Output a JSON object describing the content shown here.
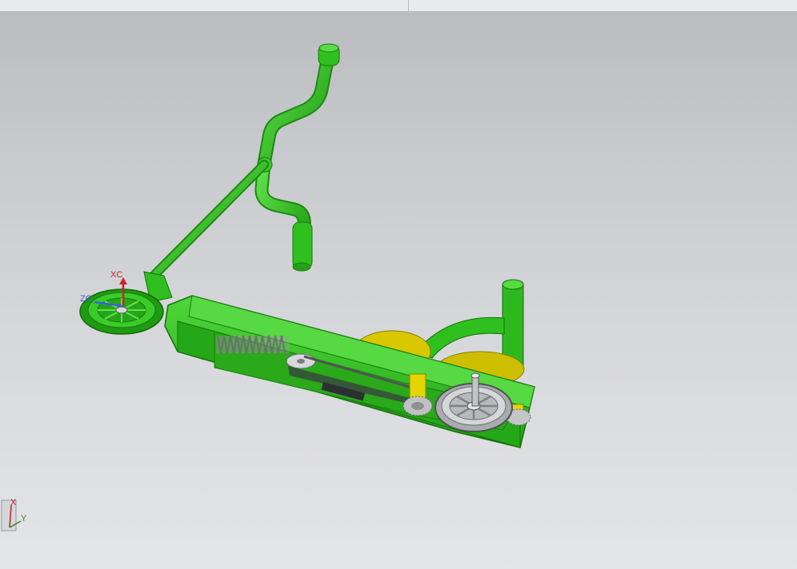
{
  "viewport": {
    "background_top": "#b9bbbe",
    "background_bottom": "#e4e5e7"
  },
  "model": {
    "frame_color": "#2fbf1f",
    "frame_dark": "#1f8a12",
    "metal_color": "#b9bcbf",
    "yellow_color": "#e4d400"
  },
  "wcs_triad": {
    "x_label": "XC",
    "z_label": "ZC"
  },
  "abs_triad": {
    "x_label": "X",
    "y_label": "Y"
  }
}
